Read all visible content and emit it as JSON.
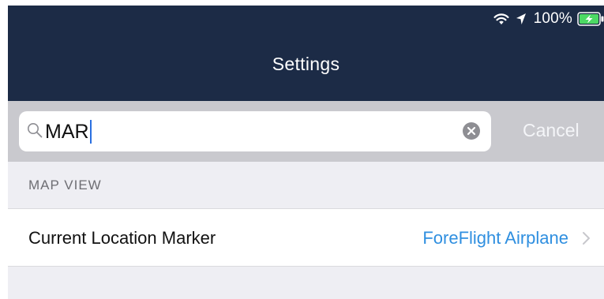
{
  "status_bar": {
    "battery_percent": "100%",
    "wifi_icon": "wifi-icon",
    "location_icon": "location-arrow-icon",
    "battery_icon": "battery-charging-icon",
    "battery_level": 1.0,
    "battery_color": "#4cd964"
  },
  "navbar": {
    "title": "Settings",
    "background": "#1c2b46"
  },
  "search": {
    "icon": "search-icon",
    "value": "MAR",
    "clear_icon": "clear-icon",
    "cancel_label": "Cancel"
  },
  "section": {
    "title": "MAP VIEW"
  },
  "rows": [
    {
      "label": "Current Location Marker",
      "value": "ForeFlight Airplane",
      "value_color": "#2f8fe0",
      "accessory_icon": "chevron-right-icon"
    }
  ]
}
